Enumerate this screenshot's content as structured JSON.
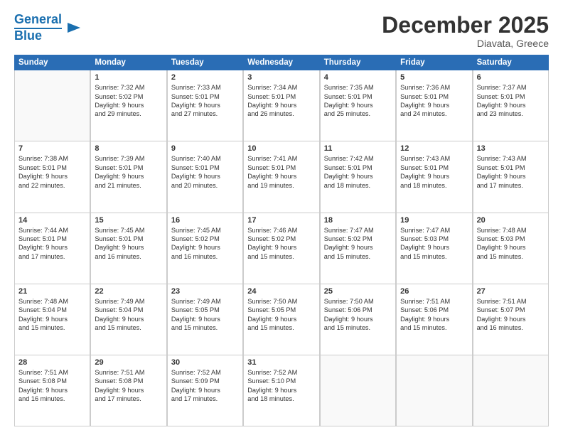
{
  "header": {
    "logo_line1": "General",
    "logo_line2": "Blue",
    "title": "December 2025",
    "subtitle": "Diavata, Greece"
  },
  "weekdays": [
    "Sunday",
    "Monday",
    "Tuesday",
    "Wednesday",
    "Thursday",
    "Friday",
    "Saturday"
  ],
  "weeks": [
    [
      {
        "day": "",
        "lines": []
      },
      {
        "day": "1",
        "lines": [
          "Sunrise: 7:32 AM",
          "Sunset: 5:02 PM",
          "Daylight: 9 hours",
          "and 29 minutes."
        ]
      },
      {
        "day": "2",
        "lines": [
          "Sunrise: 7:33 AM",
          "Sunset: 5:01 PM",
          "Daylight: 9 hours",
          "and 27 minutes."
        ]
      },
      {
        "day": "3",
        "lines": [
          "Sunrise: 7:34 AM",
          "Sunset: 5:01 PM",
          "Daylight: 9 hours",
          "and 26 minutes."
        ]
      },
      {
        "day": "4",
        "lines": [
          "Sunrise: 7:35 AM",
          "Sunset: 5:01 PM",
          "Daylight: 9 hours",
          "and 25 minutes."
        ]
      },
      {
        "day": "5",
        "lines": [
          "Sunrise: 7:36 AM",
          "Sunset: 5:01 PM",
          "Daylight: 9 hours",
          "and 24 minutes."
        ]
      },
      {
        "day": "6",
        "lines": [
          "Sunrise: 7:37 AM",
          "Sunset: 5:01 PM",
          "Daylight: 9 hours",
          "and 23 minutes."
        ]
      }
    ],
    [
      {
        "day": "7",
        "lines": [
          "Sunrise: 7:38 AM",
          "Sunset: 5:01 PM",
          "Daylight: 9 hours",
          "and 22 minutes."
        ]
      },
      {
        "day": "8",
        "lines": [
          "Sunrise: 7:39 AM",
          "Sunset: 5:01 PM",
          "Daylight: 9 hours",
          "and 21 minutes."
        ]
      },
      {
        "day": "9",
        "lines": [
          "Sunrise: 7:40 AM",
          "Sunset: 5:01 PM",
          "Daylight: 9 hours",
          "and 20 minutes."
        ]
      },
      {
        "day": "10",
        "lines": [
          "Sunrise: 7:41 AM",
          "Sunset: 5:01 PM",
          "Daylight: 9 hours",
          "and 19 minutes."
        ]
      },
      {
        "day": "11",
        "lines": [
          "Sunrise: 7:42 AM",
          "Sunset: 5:01 PM",
          "Daylight: 9 hours",
          "and 18 minutes."
        ]
      },
      {
        "day": "12",
        "lines": [
          "Sunrise: 7:43 AM",
          "Sunset: 5:01 PM",
          "Daylight: 9 hours",
          "and 18 minutes."
        ]
      },
      {
        "day": "13",
        "lines": [
          "Sunrise: 7:43 AM",
          "Sunset: 5:01 PM",
          "Daylight: 9 hours",
          "and 17 minutes."
        ]
      }
    ],
    [
      {
        "day": "14",
        "lines": [
          "Sunrise: 7:44 AM",
          "Sunset: 5:01 PM",
          "Daylight: 9 hours",
          "and 17 minutes."
        ]
      },
      {
        "day": "15",
        "lines": [
          "Sunrise: 7:45 AM",
          "Sunset: 5:01 PM",
          "Daylight: 9 hours",
          "and 16 minutes."
        ]
      },
      {
        "day": "16",
        "lines": [
          "Sunrise: 7:45 AM",
          "Sunset: 5:02 PM",
          "Daylight: 9 hours",
          "and 16 minutes."
        ]
      },
      {
        "day": "17",
        "lines": [
          "Sunrise: 7:46 AM",
          "Sunset: 5:02 PM",
          "Daylight: 9 hours",
          "and 15 minutes."
        ]
      },
      {
        "day": "18",
        "lines": [
          "Sunrise: 7:47 AM",
          "Sunset: 5:02 PM",
          "Daylight: 9 hours",
          "and 15 minutes."
        ]
      },
      {
        "day": "19",
        "lines": [
          "Sunrise: 7:47 AM",
          "Sunset: 5:03 PM",
          "Daylight: 9 hours",
          "and 15 minutes."
        ]
      },
      {
        "day": "20",
        "lines": [
          "Sunrise: 7:48 AM",
          "Sunset: 5:03 PM",
          "Daylight: 9 hours",
          "and 15 minutes."
        ]
      }
    ],
    [
      {
        "day": "21",
        "lines": [
          "Sunrise: 7:48 AM",
          "Sunset: 5:04 PM",
          "Daylight: 9 hours",
          "and 15 minutes."
        ]
      },
      {
        "day": "22",
        "lines": [
          "Sunrise: 7:49 AM",
          "Sunset: 5:04 PM",
          "Daylight: 9 hours",
          "and 15 minutes."
        ]
      },
      {
        "day": "23",
        "lines": [
          "Sunrise: 7:49 AM",
          "Sunset: 5:05 PM",
          "Daylight: 9 hours",
          "and 15 minutes."
        ]
      },
      {
        "day": "24",
        "lines": [
          "Sunrise: 7:50 AM",
          "Sunset: 5:05 PM",
          "Daylight: 9 hours",
          "and 15 minutes."
        ]
      },
      {
        "day": "25",
        "lines": [
          "Sunrise: 7:50 AM",
          "Sunset: 5:06 PM",
          "Daylight: 9 hours",
          "and 15 minutes."
        ]
      },
      {
        "day": "26",
        "lines": [
          "Sunrise: 7:51 AM",
          "Sunset: 5:06 PM",
          "Daylight: 9 hours",
          "and 15 minutes."
        ]
      },
      {
        "day": "27",
        "lines": [
          "Sunrise: 7:51 AM",
          "Sunset: 5:07 PM",
          "Daylight: 9 hours",
          "and 16 minutes."
        ]
      }
    ],
    [
      {
        "day": "28",
        "lines": [
          "Sunrise: 7:51 AM",
          "Sunset: 5:08 PM",
          "Daylight: 9 hours",
          "and 16 minutes."
        ]
      },
      {
        "day": "29",
        "lines": [
          "Sunrise: 7:51 AM",
          "Sunset: 5:08 PM",
          "Daylight: 9 hours",
          "and 17 minutes."
        ]
      },
      {
        "day": "30",
        "lines": [
          "Sunrise: 7:52 AM",
          "Sunset: 5:09 PM",
          "Daylight: 9 hours",
          "and 17 minutes."
        ]
      },
      {
        "day": "31",
        "lines": [
          "Sunrise: 7:52 AM",
          "Sunset: 5:10 PM",
          "Daylight: 9 hours",
          "and 18 minutes."
        ]
      },
      {
        "day": "",
        "lines": []
      },
      {
        "day": "",
        "lines": []
      },
      {
        "day": "",
        "lines": []
      }
    ]
  ]
}
